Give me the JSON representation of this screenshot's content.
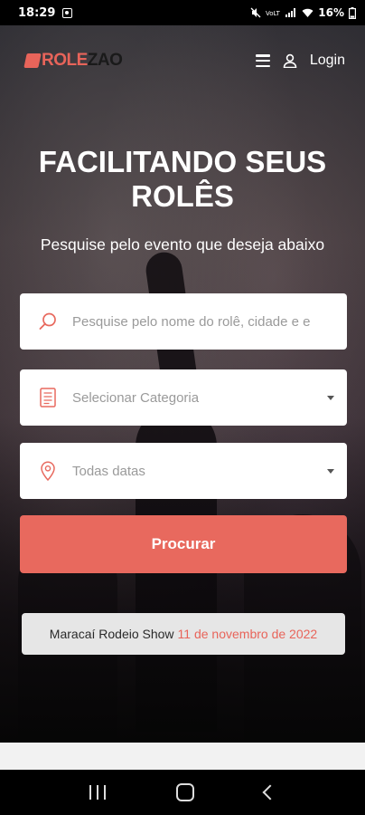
{
  "status_bar": {
    "time": "18:29",
    "battery": "16%"
  },
  "header": {
    "logo_part1": "ROLE",
    "logo_part2": "ZAO",
    "login_label": "Login"
  },
  "hero": {
    "headline": "FACILITANDO SEUS ROLÊS",
    "subtitle": "Pesquise pelo evento que deseja abaixo"
  },
  "search": {
    "placeholder": "Pesquise pelo nome do rolê, cidade e e",
    "category_value": "Selecionar Categoria",
    "date_value": "Todas datas",
    "submit_label": "Procurar"
  },
  "featured_event": {
    "name": "Maracaí Rodeio Show",
    "date": "11 de novembro de 2022"
  },
  "colors": {
    "accent": "#e8695e",
    "field_bg": "#ffffff",
    "chip_bg": "#e6e6e6"
  }
}
